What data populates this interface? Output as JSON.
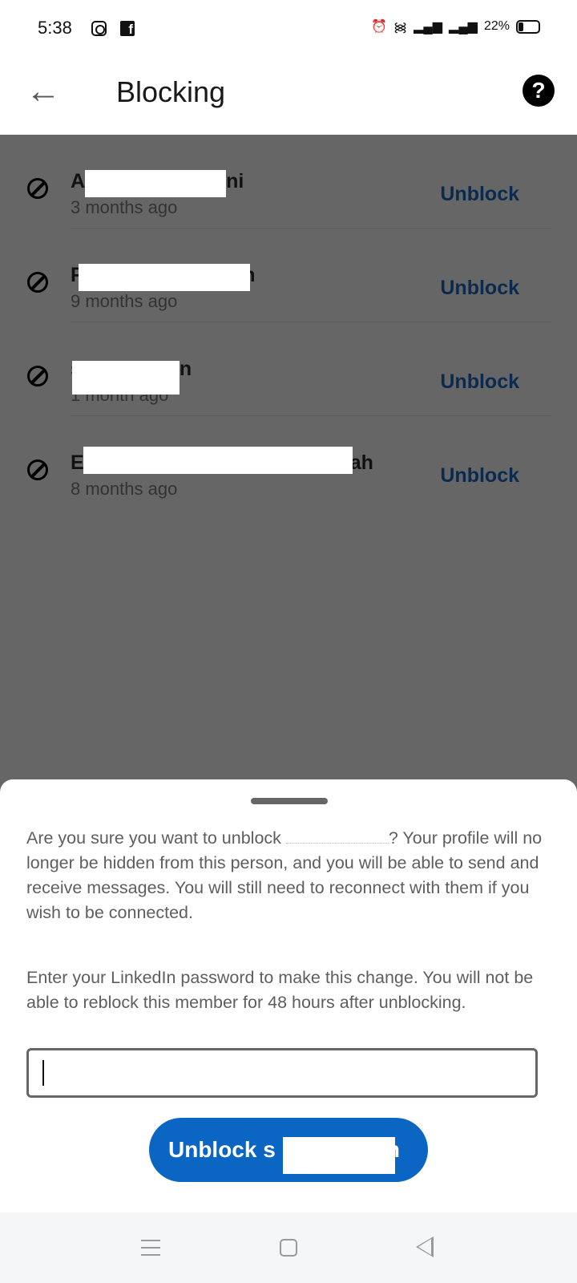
{
  "status_bar": {
    "time": "5:38",
    "battery": "22%",
    "notification_icons": [
      "instagram-icon",
      "facebook-icon"
    ],
    "system_icons": [
      "alarm-icon",
      "wifi-icon",
      "signal-icon",
      "signal-icon",
      "battery-icon"
    ]
  },
  "app_bar": {
    "title": "Blocking",
    "help": "?"
  },
  "blocked": [
    {
      "name_start": "A",
      "name_end": "ni",
      "time": "3 months ago",
      "action": "Unblock"
    },
    {
      "name_start": "F",
      "name_end": "n",
      "time": "9 months ago",
      "action": "Unblock"
    },
    {
      "name_start": "s",
      "name_end": "n",
      "time": "1 month ago",
      "action": "Unblock"
    },
    {
      "name_start": "E",
      "name_end": "ah",
      "time": "8 months ago",
      "action": "Unblock"
    }
  ],
  "sheet": {
    "confirm_start": "Are you sure you want to unblock ",
    "confirm_end": "? Your profile will no longer be hidden from this person, and you will be able to send and receive messages. You will still need to reconnect with them if you wish to be connected.",
    "password_prompt": "Enter your LinkedIn password to make this change. You will not be able to reblock this member for 48 hours after unblocking.",
    "password_value": "",
    "button_start": "Unblock s",
    "button_end": "n"
  },
  "colors": {
    "primary": "#0a66c2",
    "unblock_link": "#0b2a4f",
    "scrim": "#666666"
  }
}
